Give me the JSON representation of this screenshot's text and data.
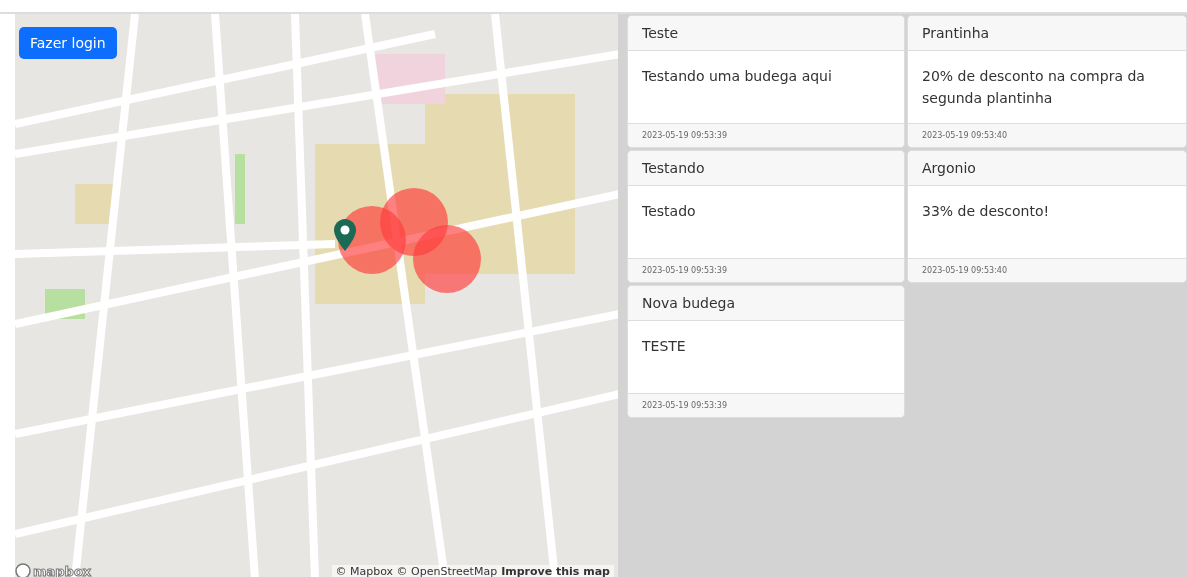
{
  "map": {
    "login_button": "Fazer login",
    "logo": "mapbox",
    "attribution": "© Mapbox © OpenStreetMap",
    "improve_link": "Improve this map"
  },
  "cards": [
    {
      "title": "Teste",
      "body": "Testando uma budega aqui",
      "date": "2023-05-19 09:53:39"
    },
    {
      "title": "Prantinha",
      "body": "20% de desconto na compra da segunda plantinha",
      "date": "2023-05-19 09:53:40"
    },
    {
      "title": "Testando",
      "body": "Testado",
      "date": "2023-05-19 09:53:39"
    },
    {
      "title": "Argonio",
      "body": "33% de desconto!",
      "date": "2023-05-19 09:53:40"
    },
    {
      "title": "Nova budega",
      "body": "TESTE",
      "date": "2023-05-19 09:53:39"
    }
  ]
}
